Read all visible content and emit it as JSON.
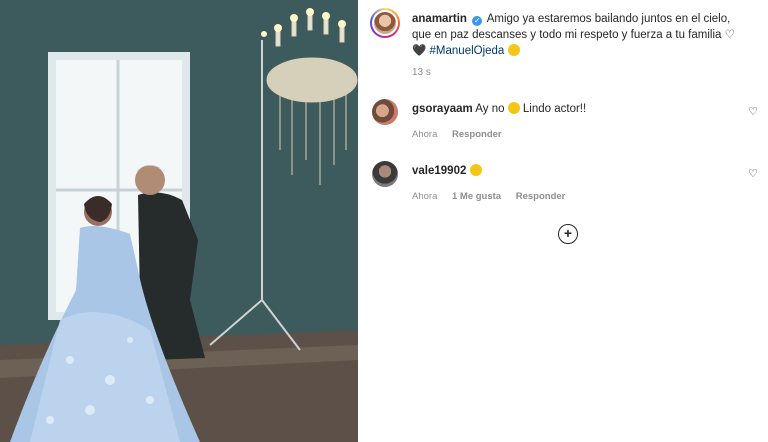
{
  "post": {
    "username": "anamartin",
    "caption_text": "Amigo ya estaremos bailando juntos en el cielo, que en paz descanses y todo mi respeto y fuerza a tu familia",
    "heart_symbol_outline": "♡",
    "heart_symbol_black": "🖤",
    "hashtag": "#ManuelOjeda",
    "time": "13 s"
  },
  "comments": [
    {
      "username": "gsorayaam",
      "text_before": "Ay no",
      "text_after": "Lindo actor!!",
      "time": "Ahora",
      "likes": "",
      "reply_label": "Responder"
    },
    {
      "username": "vale19902",
      "text_before": "",
      "text_after": "",
      "time": "Ahora",
      "likes": "1 Me gusta",
      "reply_label": "Responder"
    }
  ],
  "load_more_symbol": "+",
  "colors": {
    "link": "#00376b",
    "meta": "#8e8e8e",
    "text": "#262626",
    "verified": "#3897f0"
  }
}
